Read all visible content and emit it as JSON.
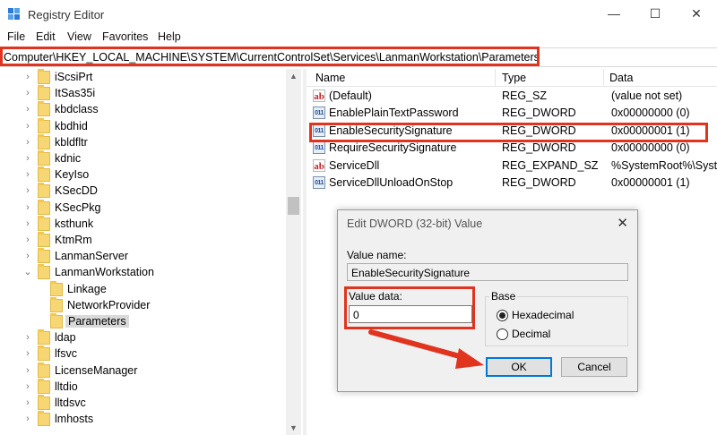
{
  "window": {
    "title": "Registry Editor",
    "minimize_glyph": "—",
    "maximize_glyph": "☐",
    "close_glyph": "✕"
  },
  "menu": {
    "items": [
      "File",
      "Edit",
      "View",
      "Favorites",
      "Help"
    ]
  },
  "address": {
    "path": "Computer\\HKEY_LOCAL_MACHINE\\SYSTEM\\CurrentControlSet\\Services\\LanmanWorkstation\\Parameters"
  },
  "tree": {
    "items": [
      {
        "label": "iScsiPrt",
        "expandable": true
      },
      {
        "label": "ItSas35i",
        "expandable": true
      },
      {
        "label": "kbdclass",
        "expandable": true
      },
      {
        "label": "kbdhid",
        "expandable": true
      },
      {
        "label": "kbldfltr",
        "expandable": true
      },
      {
        "label": "kdnic",
        "expandable": true
      },
      {
        "label": "KeyIso",
        "expandable": true
      },
      {
        "label": "KSecDD",
        "expandable": true
      },
      {
        "label": "KSecPkg",
        "expandable": true
      },
      {
        "label": "ksthunk",
        "expandable": true
      },
      {
        "label": "KtmRm",
        "expandable": true
      },
      {
        "label": "LanmanServer",
        "expandable": true
      },
      {
        "label": "LanmanWorkstation",
        "expandable": true,
        "expanded": true
      },
      {
        "label": "Linkage",
        "child": true
      },
      {
        "label": "NetworkProvider",
        "child": true
      },
      {
        "label": "Parameters",
        "child": true,
        "selected": true
      },
      {
        "label": "ldap",
        "expandable": true
      },
      {
        "label": "lfsvc",
        "expandable": true
      },
      {
        "label": "LicenseManager",
        "expandable": true
      },
      {
        "label": "lltdio",
        "expandable": true
      },
      {
        "label": "lltdsvc",
        "expandable": true
      },
      {
        "label": "lmhosts",
        "expandable": true
      }
    ]
  },
  "list": {
    "columns": [
      "Name",
      "Type",
      "Data"
    ],
    "rows": [
      {
        "icon": "string-value-icon",
        "name": "(Default)",
        "type": "REG_SZ",
        "data": "(value not set)"
      },
      {
        "icon": "dword-value-icon",
        "name": "EnablePlainTextPassword",
        "type": "REG_DWORD",
        "data": "0x00000000 (0)"
      },
      {
        "icon": "dword-value-icon",
        "name": "EnableSecuritySignature",
        "type": "REG_DWORD",
        "data": "0x00000001 (1)",
        "highlighted": true
      },
      {
        "icon": "dword-value-icon",
        "name": "RequireSecuritySignature",
        "type": "REG_DWORD",
        "data": "0x00000000 (0)"
      },
      {
        "icon": "string-value-icon",
        "name": "ServiceDll",
        "type": "REG_EXPAND_SZ",
        "data": "%SystemRoot%\\Syste"
      },
      {
        "icon": "dword-value-icon",
        "name": "ServiceDllUnloadOnStop",
        "type": "REG_DWORD",
        "data": "0x00000001 (1)"
      }
    ]
  },
  "dialog": {
    "title": "Edit DWORD (32-bit) Value",
    "value_name_label": "Value name:",
    "value_name": "EnableSecuritySignature",
    "value_data_label": "Value data:",
    "value_data": "0",
    "base_label": "Base",
    "hex_label": "Hexadecimal",
    "dec_label": "Decimal",
    "base_selected": "Hexadecimal",
    "ok_label": "OK",
    "cancel_label": "Cancel",
    "close_glyph": "✕"
  },
  "colors": {
    "highlight_red": "#e0341f",
    "folder_yellow": "#f7d774",
    "accent_blue": "#0078d7"
  }
}
